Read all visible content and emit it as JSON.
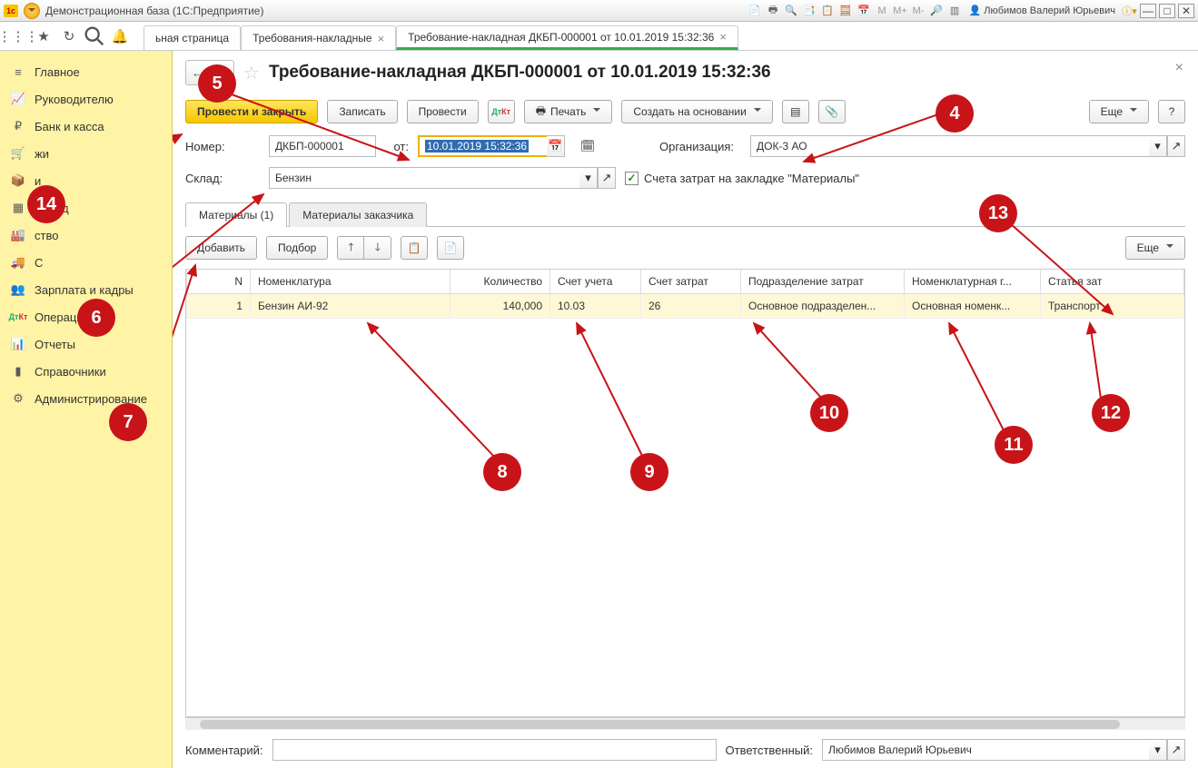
{
  "titlebar": {
    "title": "Демонстрационная база  (1С:Предприятие)",
    "user": "Любимов Валерий Юрьевич"
  },
  "tabs": [
    {
      "label": "ьная страница",
      "closable": false
    },
    {
      "label": "Требования-накладные",
      "closable": true
    },
    {
      "label": "Требование-накладная ДКБП-000001 от 10.01.2019 15:32:36",
      "closable": true,
      "active": true
    }
  ],
  "sidebar": [
    "Главное",
    "Руководителю",
    "Банк и касса",
    "жи",
    "и",
    "Склад",
    "ство",
    "С",
    "Зарплата и кадры",
    "Операции",
    "Отчеты",
    "Справочники",
    "Администрирование"
  ],
  "doc": {
    "title": "Требование-накладная ДКБП-000001 от 10.01.2019 15:32:36",
    "buttons": {
      "post_close": "Провести и закрыть",
      "save": "Записать",
      "post": "Провести",
      "print": "Печать",
      "create_based": "Создать на основании",
      "more": "Еще"
    },
    "fields": {
      "number_label": "Номер:",
      "number": "ДКБП-000001",
      "date_label": "от:",
      "date": "10.01.2019 15:32:36",
      "org_label": "Организация:",
      "org": "ДОК-3 АО",
      "warehouse_label": "Склад:",
      "warehouse": "Бензин",
      "checkbox_label": "Счета затрат на закладке \"Материалы\""
    },
    "subtabs": [
      "Материалы (1)",
      "Материалы заказчика"
    ],
    "tabbar": {
      "add": "Добавить",
      "pick": "Подбор",
      "more": "Еще"
    },
    "grid": {
      "cols": [
        "N",
        "Номенклатура",
        "Количество",
        "Счет учета",
        "Счет затрат",
        "Подразделение затрат",
        "Номенклатурная г...",
        "Статья зат"
      ],
      "rows": [
        {
          "n": "1",
          "nom": "Бензин АИ-92",
          "qty": "140,000",
          "acct": "10.03",
          "cost_acct": "26",
          "dept": "Основное подразделен...",
          "group": "Основная номенк...",
          "item": "Транспорт"
        }
      ]
    },
    "foot": {
      "comment_label": "Комментарий:",
      "comment": "",
      "responsible_label": "Ответственный:",
      "responsible": "Любимов Валерий Юрьевич"
    }
  },
  "callouts": [
    "4",
    "5",
    "6",
    "7",
    "8",
    "9",
    "10",
    "11",
    "12",
    "13",
    "14"
  ]
}
